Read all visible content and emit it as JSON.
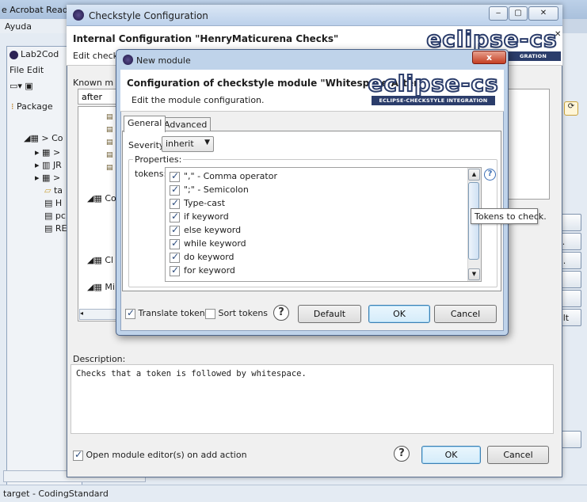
{
  "background_app": {
    "title_fragment": "e Acrobat Read",
    "menu_fragment": "Ayuda",
    "window_title_fragment": "Lab2Cod",
    "menu_items": "File  Edit",
    "package_label": "Package",
    "tree_items": [
      "> Co",
      "> ",
      "JR",
      "> ",
      "ta",
      "H",
      "pc",
      "RE"
    ],
    "status_text": "target - CodingStandard",
    "right_buttons": [
      "s...",
      "e...",
      "e",
      "ault"
    ]
  },
  "checkstyle_dialog": {
    "title": "Checkstyle Configuration",
    "banner_title": "Internal Configuration \"HenryMaticurena Checks\"",
    "banner_subtitle": "Edit check",
    "known_modules_label": "Known m",
    "filter_value": "after",
    "tree_items": [
      "Co",
      "Cl",
      "Mi"
    ],
    "description_label": "Description:",
    "description_text": "Checks that a token is followed by whitespace.",
    "open_editor_label": "Open module editor(s) on add action",
    "open_editor_checked": true,
    "ok_label": "OK",
    "cancel_label": "Cancel",
    "logo_word": "eclipse-cs",
    "logo_band_partial": "GRATION"
  },
  "new_module_dialog": {
    "title": "New module",
    "close_label": "x",
    "banner_title": "Configuration of checkstyle module \"Whitespace After\"",
    "banner_subtitle": "Edit the module configuration.",
    "logo_word": "eclipse-cs",
    "logo_band": "ECLIPSE-CHECKSTYLE INTEGRATION",
    "tabs": [
      {
        "label": "General",
        "active": true
      },
      {
        "label": "Advanced",
        "active": false
      }
    ],
    "severity_label": "Severity:",
    "severity_value": "inherit",
    "properties_label": "Properties:",
    "tokens_label": "tokens:",
    "tokens": [
      {
        "label": "\",\" - Comma operator",
        "checked": true
      },
      {
        "label": "\";\" - Semicolon",
        "checked": true
      },
      {
        "label": "Type-cast",
        "checked": true
      },
      {
        "label": "if keyword",
        "checked": true
      },
      {
        "label": "else keyword",
        "checked": true
      },
      {
        "label": "while keyword",
        "checked": true
      },
      {
        "label": "do keyword",
        "checked": true
      },
      {
        "label": "for keyword",
        "checked": true
      }
    ],
    "tooltip": "Tokens to check.",
    "translate_tokens_label": "Translate tokens",
    "translate_tokens_checked": true,
    "sort_tokens_label": "Sort tokens",
    "sort_tokens_checked": false,
    "default_label": "Default",
    "ok_label": "OK",
    "cancel_label": "Cancel"
  },
  "colors": {
    "logo_dark": "#2b3d6b",
    "title_gradient": "#bcd1eb",
    "default_button_border": "#3c7fb1"
  }
}
